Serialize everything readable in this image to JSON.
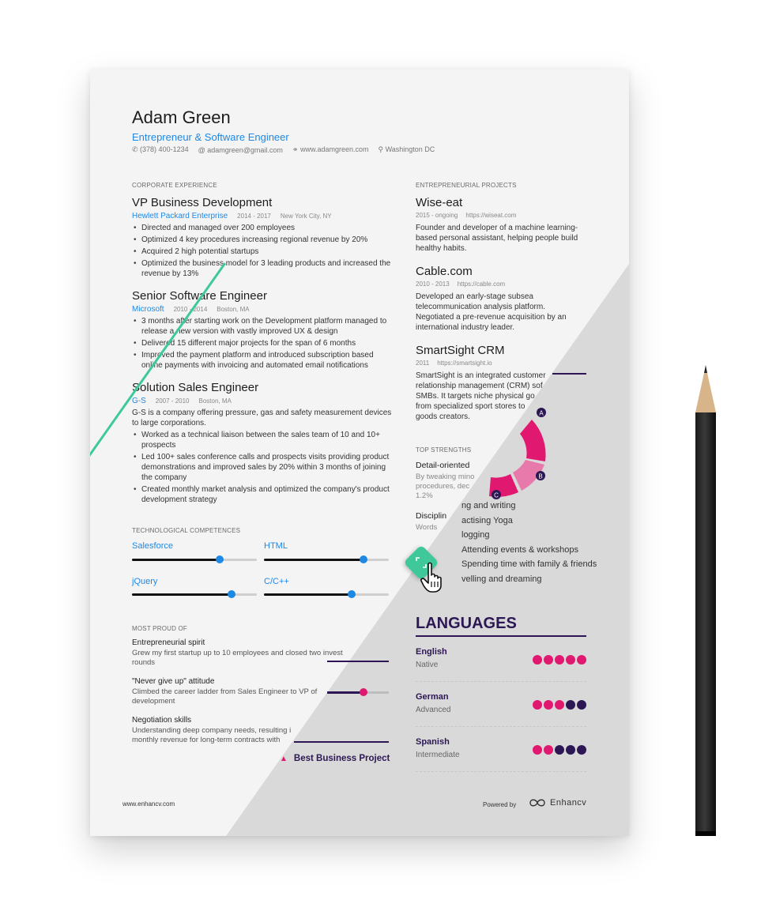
{
  "resume": {
    "name": "Adam Green",
    "title": "Entrepreneur & Software Engineer",
    "contact": {
      "phone": "(378) 400-1234",
      "email": "adamgreen@gmail.com",
      "website": "www.adamgreen.com",
      "location": "Washington DC"
    },
    "experience": {
      "heading": "CORPORATE EXPERIENCE",
      "jobs": [
        {
          "title": "VP Business Development",
          "company": "Hewlett Packard Enterprise",
          "dates": "2014 - 2017",
          "location": "New York City, NY",
          "bullets": [
            "Directed and managed over 200 employees",
            "Optimized 4 key procedures increasing regional revenue by 20%",
            "Acquired 2 high potential startups",
            "Optimized the business model for 3 leading products and increased the revenue by 13%"
          ]
        },
        {
          "title": "Senior Software Engineer",
          "company": "Microsoft",
          "dates": "2010 - 2014",
          "location": "Boston, MA",
          "bullets": [
            "3 months after starting work on the Development platform managed to release a new version with vastly improved UX & design",
            "Delivered 15 different major projects for the span of 6 months",
            "Improved the payment platform and introduced subscription based online payments with invoicing and automated email notifications"
          ]
        },
        {
          "title": "Solution Sales Engineer",
          "company": "G-S",
          "dates": "2007 - 2010",
          "location": "Boston, MA",
          "summary": "G-S is a company offering pressure, gas and safety measurement devices to large corporations.",
          "bullets": [
            "Worked as a technical liaison between the sales team of 10 and 10+ prospects",
            "Led 100+ sales conference calls and prospects visits providing product demonstrations and improved sales by 20% within 3 months of joining the company",
            "Created monthly market analysis and optimized the company's product development strategy"
          ]
        }
      ]
    },
    "skills": {
      "heading": "TECHNOLOGICAL COMPETENCES",
      "items": [
        {
          "name": "Salesforce",
          "level": 0.7
        },
        {
          "name": "HTML",
          "level": 0.8
        },
        {
          "name": "jQuery",
          "level": 0.8
        },
        {
          "name": "C/C++",
          "level": 0.7
        }
      ]
    },
    "proud": {
      "heading": "MOST PROUD OF",
      "items": [
        {
          "title": "Entrepreneurial spirit",
          "desc1": "Grew my first startup up to 10 employees and closed two invest",
          "desc2": "rounds"
        },
        {
          "title": "\"Never give up\" attitude",
          "desc1": "Climbed the career ladder from Sales Engineer to VP of",
          "desc2": "development"
        },
        {
          "title": "Negotiation skills",
          "desc1": "Understanding deep company needs, resulting i",
          "desc2": "monthly revenue for long-term contracts with"
        }
      ]
    },
    "projects": {
      "heading": "ENTREPRENEURIAL PROJECTS",
      "items": [
        {
          "title": "Wise-eat",
          "dates": "2015 - ongoing",
          "url": "https://wiseat.com",
          "desc": [
            "Founder and developer of a machine learning-",
            "based personal assistant, helping people build",
            "healthy habits."
          ]
        },
        {
          "title": "Cable.com",
          "dates": "2010 - 2013",
          "url": "https://cable.com",
          "desc": [
            "Developed an early-stage subsea",
            "telecommunication analysis platform.",
            "Negotiated a pre-revenue acquisition by an",
            "international industry leader."
          ]
        },
        {
          "title": "SmartSight CRM",
          "dates": "2011",
          "url": "https://smartsight.io",
          "desc": [
            "SmartSight is an integrated customer",
            "relationship management (CRM) sof",
            "SMBs. It targets niche physical go",
            "from specialized sport stores to",
            "goods creators."
          ]
        }
      ]
    },
    "strengths": {
      "heading": "TOP STRENGTHS",
      "items": [
        {
          "title": "Detail-oriented",
          "desc": [
            "By tweaking mino",
            "procedures, dec",
            "1.2%"
          ]
        },
        {
          "title": "Disciplin",
          "desc": [
            "Words"
          ]
        }
      ]
    },
    "hobbies": [
      "ng and writing",
      "actising Yoga",
      "logging",
      "Attending events & workshops",
      "Spending time with family & friends",
      "velling and dreaming"
    ],
    "donut_labels": [
      "A",
      "B",
      "C"
    ],
    "best_project": "Best Business Project",
    "languages": {
      "heading": "LANGUAGES",
      "items": [
        {
          "name": "English",
          "level_text": "Native",
          "level": 5
        },
        {
          "name": "German",
          "level_text": "Advanced",
          "level": 3
        },
        {
          "name": "Spanish",
          "level_text": "Intermediate",
          "level": 2
        }
      ]
    },
    "footer": {
      "website": "www.enhancv.com",
      "powered_by": "Powered by",
      "brand": "Enhancv"
    }
  },
  "colors": {
    "accent_blue": "#1e88e5",
    "magenta": "#e0186f",
    "navy": "#2c1654",
    "green": "#3fc99a"
  }
}
